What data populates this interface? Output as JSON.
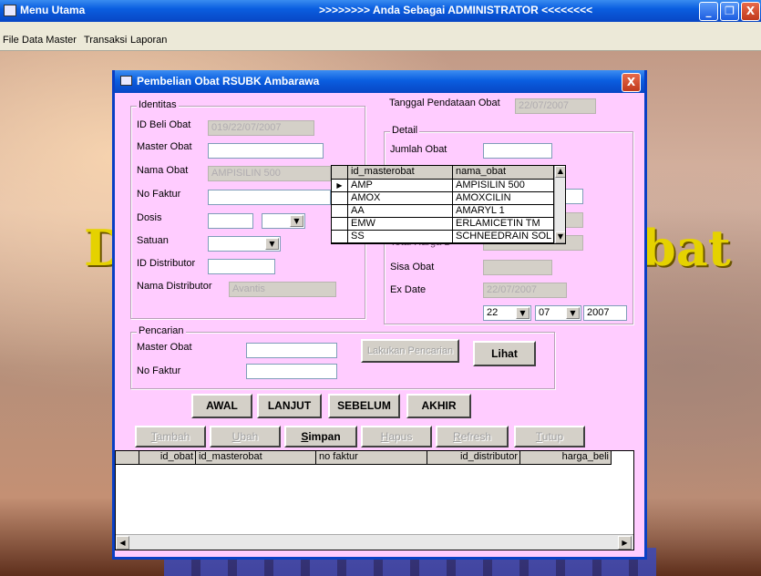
{
  "main_window": {
    "title": "Menu Utama",
    "admin_text": ">>>>>>>> Anda Sebagai ADMINISTRATOR <<<<<<<<",
    "minimize": "_",
    "restore": "❐",
    "close": "X"
  },
  "menu": [
    "File",
    "Data Master",
    "Transaksi",
    "Laporan"
  ],
  "background_text": {
    "left": "D",
    "right": "bat"
  },
  "dialog": {
    "title": "Pembelian Obat RSUBK Ambarawa",
    "close": "X",
    "identitas": {
      "legend": "Identitas",
      "id_beli_obat_label": "ID Beli Obat",
      "id_beli_obat": "019/22/07/2007",
      "master_obat_label": "Master Obat",
      "master_obat": "",
      "nama_obat_label": "Nama Obat",
      "nama_obat": "AMPISILIN 500",
      "no_faktur_label": "No Faktur",
      "no_faktur": "",
      "dosis_label": "Dosis",
      "satuan_label": "Satuan",
      "id_distributor_label": "ID Distributor",
      "id_distributor": "",
      "nama_distributor_label": "Nama Distributor",
      "nama_distributor": "Avantis"
    },
    "tanggal_label": "Tanggal Pendataan Obat",
    "tanggal": "22/07/2007",
    "detail": {
      "legend": "Detail",
      "jumlah_obat_label": "Jumlah Obat",
      "jumlah_obat": "",
      "total_harga_label": "Total Harga B",
      "sisa_obat_label": "Sisa Obat",
      "ex_date_label": "Ex Date",
      "ex_date": "22/07/2007",
      "day": "22",
      "month": "07",
      "year": "2007"
    },
    "popup": {
      "headers": [
        "id_masterobat",
        "nama_obat"
      ],
      "rows": [
        [
          "AMP",
          "AMPISILIN 500"
        ],
        [
          "AMOX",
          "AMOXCILIN"
        ],
        [
          "AA",
          "AMARYL 1"
        ],
        [
          "EMW",
          "ERLAMICETIN TM"
        ],
        [
          "SS",
          "SCHNEEDRAIN SOL"
        ]
      ]
    },
    "pencarian": {
      "legend": "Pencarian",
      "master_obat_label": "Master Obat",
      "no_faktur_label": "No Faktur",
      "search_button": "Lakukan Pencarian",
      "view_button": "Lihat"
    },
    "nav": {
      "awal": "AWAL",
      "lanjut": "LANJUT",
      "sebelum": "SEBELUM",
      "akhir": "AKHIR"
    },
    "actions": {
      "tambah_first": "T",
      "tambah_rest": "ambah",
      "ubah_first": "U",
      "ubah_rest": "bah",
      "simpan_first": "S",
      "simpan_rest": "impan",
      "hapus_first": "H",
      "hapus_rest": "apus",
      "refresh_first": "R",
      "refresh_rest": "efresh",
      "tutup_first": "T",
      "tutup_rest": "utup"
    },
    "grid": {
      "headers": [
        "id_obat",
        "id_masterobat",
        "no faktur",
        "id_distributor",
        "harga_beli"
      ]
    }
  }
}
